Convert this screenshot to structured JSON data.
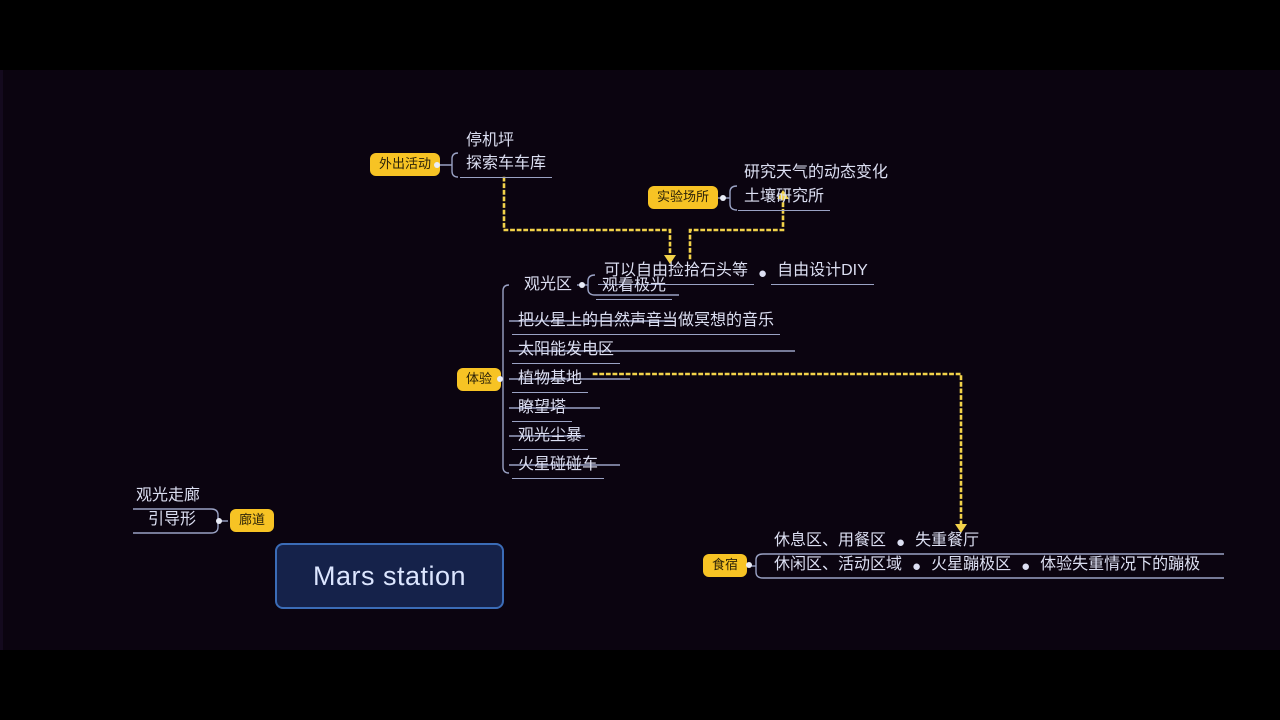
{
  "canvas": {
    "background": "#0b0410",
    "accent_pill": "#f7c324",
    "accent_line": "#f2d24a",
    "text_color": "#dcdff2",
    "central_fill": "#15224a",
    "central_border": "#3b6cb7"
  },
  "central": {
    "label": "Mars station"
  },
  "branches": {
    "outing": {
      "pill": "外出活动",
      "float_label": "停机坪",
      "child": "探索车车库"
    },
    "lab": {
      "pill": "实验场所",
      "float_label": "研究天气的动态变化",
      "child": "土壤研究所"
    },
    "experience": {
      "pill": "体验",
      "sight_label": "观光区",
      "sight_row": [
        "可以自由捡拾石头等",
        "自由设计DIY"
      ],
      "sight_child": "观看极光",
      "items": [
        "把火星上的自然声音当做冥想的音乐",
        "太阳能发电区",
        "植物基地",
        "瞭望塔",
        "观光尘暴",
        "火星碰碰车"
      ]
    },
    "corridor": {
      "pill": "廊道",
      "float_label": "观光走廊",
      "child": "引导形"
    },
    "lodging": {
      "pill": "食宿",
      "top_row": [
        "休息区、用餐区",
        "失重餐厅"
      ],
      "bottom_row": [
        "休闲区、活动区域",
        "火星蹦极区",
        "体验失重情况下的蹦极"
      ]
    }
  },
  "separator": "●"
}
